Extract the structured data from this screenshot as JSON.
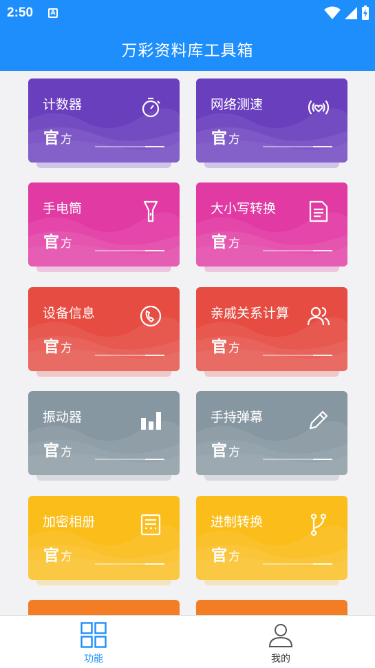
{
  "status_bar": {
    "time": "2:50",
    "notif_icon_letter": "A"
  },
  "app_bar": {
    "title": "万彩资料库工具箱"
  },
  "official_big": "官",
  "official_small": "方",
  "cards": [
    {
      "title": "计数器",
      "icon": "stopwatch-icon",
      "color": "#6a3fbe"
    },
    {
      "title": "网络测速",
      "icon": "signal-heart-icon",
      "color": "#6a3fbe"
    },
    {
      "title": "手电筒",
      "icon": "flashlight-icon",
      "color": "#e23aa3"
    },
    {
      "title": "大小写转换",
      "icon": "document-icon",
      "color": "#e23aa3"
    },
    {
      "title": "设备信息",
      "icon": "phone-call-icon",
      "color": "#e64c42"
    },
    {
      "title": "亲戚关系计算",
      "icon": "people-icon",
      "color": "#e64c42"
    },
    {
      "title": "振动器",
      "icon": "bar-chart-icon",
      "color": "#8797a1"
    },
    {
      "title": "手持弹幕",
      "icon": "pencil-icon",
      "color": "#8797a1"
    },
    {
      "title": "加密相册",
      "icon": "album-icon",
      "color": "#fbbd1a"
    },
    {
      "title": "进制转换",
      "icon": "branch-icon",
      "color": "#fbbd1a"
    },
    {
      "title": "",
      "icon": "",
      "color": "#f27d25"
    },
    {
      "title": "",
      "icon": "",
      "color": "#f27d25"
    }
  ],
  "bottom_nav": {
    "items": [
      {
        "label": "功能",
        "icon": "grid-icon",
        "active": true
      },
      {
        "label": "我的",
        "icon": "user-icon",
        "active": false
      }
    ],
    "active_color": "#1d8efc",
    "inactive_color": "#333333"
  }
}
